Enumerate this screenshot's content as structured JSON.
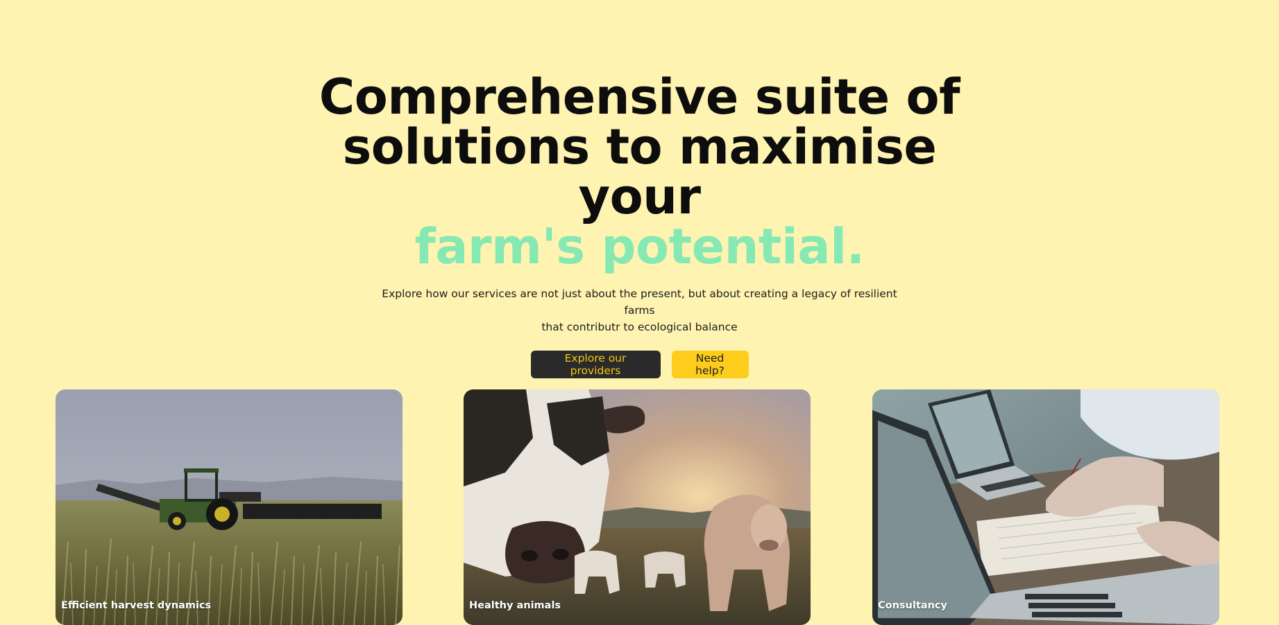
{
  "hero": {
    "headline_line1": "Comprehensive suite of",
    "headline_line2": "solutions to maximise your",
    "headline_accent": "farm's potential.",
    "subtitle_line1": "Explore how our services are not just about the present, but about creating a legacy of resilient farms",
    "subtitle_line2": "that contributr to ecological balance",
    "primary_button": "Explore our providers",
    "secondary_button": "Need help?"
  },
  "colors": {
    "background": "#fef3b1",
    "accent": "#86e8b3",
    "primary_button_bg": "#2a2a2a",
    "primary_button_text": "#f5c518",
    "secondary_button_bg": "#fccd1c"
  },
  "cards": [
    {
      "label": "Efficient harvest dynamics",
      "image": "tractor-in-field-photo"
    },
    {
      "label": "Healthy animals",
      "image": "cows-at-sunset-photo"
    },
    {
      "label": "Consultancy",
      "image": "laptops-and-notes-photo"
    }
  ]
}
